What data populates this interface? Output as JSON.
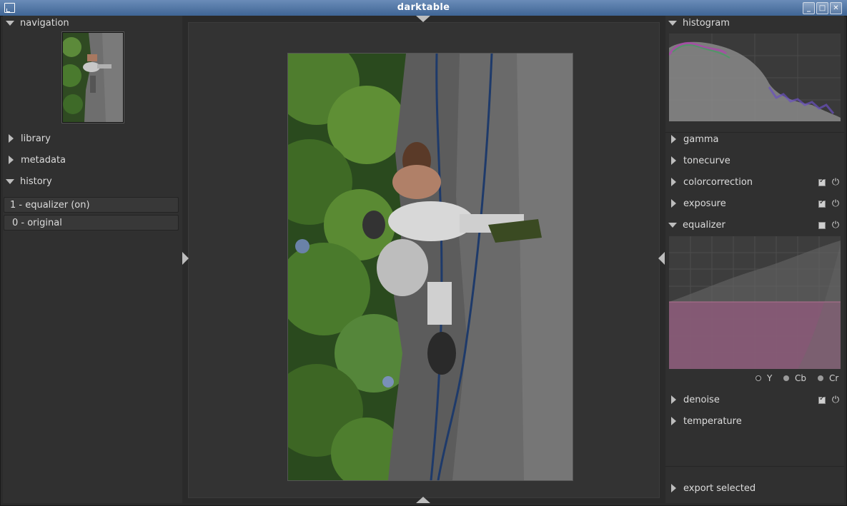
{
  "window": {
    "title": "darktable",
    "minimize": "_",
    "maximize": "□",
    "close": "✕"
  },
  "left": {
    "navigation": "navigation",
    "library": "library",
    "metadata": "metadata",
    "history": "history",
    "history_items": [
      "1 - equalizer (on)",
      "0 - original"
    ]
  },
  "right": {
    "histogram": "histogram",
    "modules": {
      "gamma": "gamma",
      "tonecurve": "tonecurve",
      "colorcorrection": "colorcorrection",
      "exposure": "exposure",
      "equalizer": "equalizer",
      "denoise": "denoise",
      "temperature": "temperature"
    },
    "module_enabled": {
      "colorcorrection": true,
      "exposure": true,
      "equalizer": false,
      "denoise": true
    },
    "channels": [
      "Y",
      "Cb",
      "Cr"
    ],
    "selected_channel": "Y",
    "export": "export selected"
  },
  "icons": {
    "power": "⏻"
  },
  "colors": {
    "titlebar": "#4f74a4",
    "panel": "#303030",
    "equalizer_fill": "#8a5a78"
  }
}
